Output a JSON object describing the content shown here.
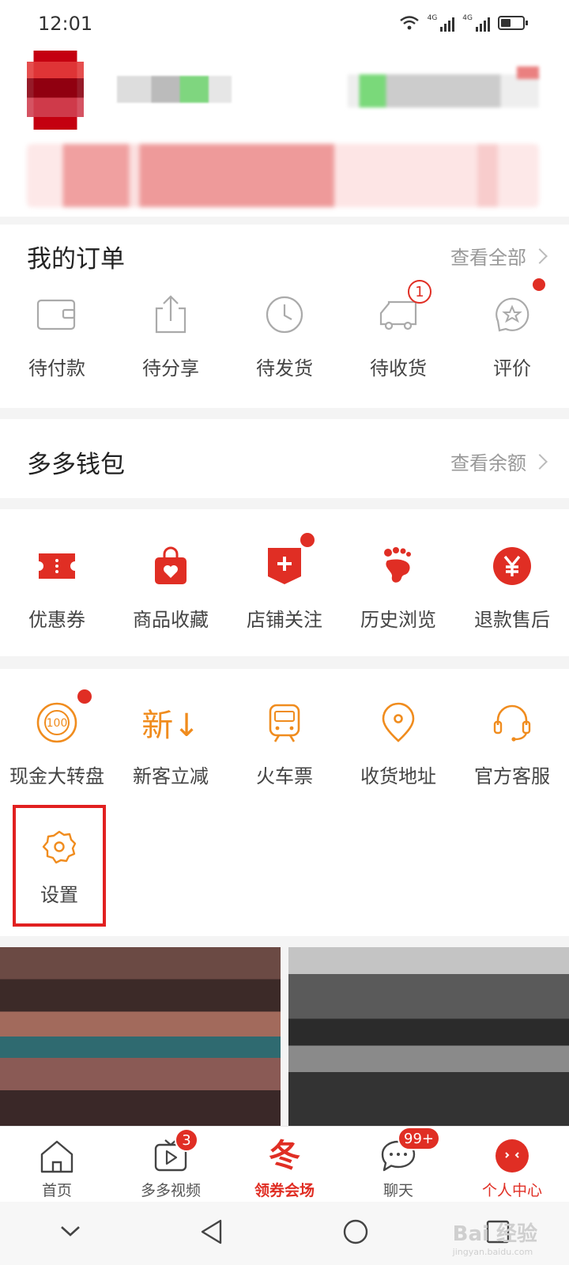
{
  "status": {
    "time": "12:01",
    "net1": "4G",
    "net2": "4G"
  },
  "orders": {
    "title": "我的订单",
    "view_all": "查看全部",
    "items": [
      {
        "label": "待付款",
        "icon": "wallet-icon"
      },
      {
        "label": "待分享",
        "icon": "share-icon"
      },
      {
        "label": "待发货",
        "icon": "clock-icon"
      },
      {
        "label": "待收货",
        "icon": "truck-icon",
        "badge": "1"
      },
      {
        "label": "评价",
        "icon": "review-star-icon",
        "dot": true
      }
    ]
  },
  "wallet": {
    "title": "多多钱包",
    "link": "查看余额"
  },
  "shortcuts": {
    "items": [
      {
        "label": "优惠券",
        "icon": "coupon-icon"
      },
      {
        "label": "商品收藏",
        "icon": "favorite-bag-icon"
      },
      {
        "label": "店铺关注",
        "icon": "shop-follow-icon",
        "dot": true
      },
      {
        "label": "历史浏览",
        "icon": "footprint-icon"
      },
      {
        "label": "退款售后",
        "icon": "refund-yen-icon"
      }
    ]
  },
  "services": {
    "items": [
      {
        "label": "现金大转盘",
        "icon": "cash-wheel-icon",
        "dot": true,
        "icon_text": "100"
      },
      {
        "label": "新客立减",
        "icon": "new-customer-icon",
        "icon_text": "新↓"
      },
      {
        "label": "火车票",
        "icon": "train-icon"
      },
      {
        "label": "收货地址",
        "icon": "location-icon"
      },
      {
        "label": "官方客服",
        "icon": "headset-icon"
      }
    ],
    "settings": {
      "label": "设置",
      "icon": "gear-icon"
    }
  },
  "tabbar": {
    "tabs": [
      {
        "label": "首页",
        "icon": "home-icon"
      },
      {
        "label": "多多视频",
        "icon": "video-icon",
        "badge": "3"
      },
      {
        "label": "领券会场",
        "icon": "winter-coupon-icon",
        "icon_text": "冬"
      },
      {
        "label": "聊天",
        "icon": "chat-icon",
        "badge": "99+"
      },
      {
        "label": "个人中心",
        "icon": "profile-icon"
      }
    ]
  },
  "watermark": {
    "main": "Bai 经验",
    "sub": "jingyan.baidu.com"
  },
  "colors": {
    "brand": "#e02e24",
    "orange": "#f08c1e",
    "highlight_box": "#e12020"
  }
}
